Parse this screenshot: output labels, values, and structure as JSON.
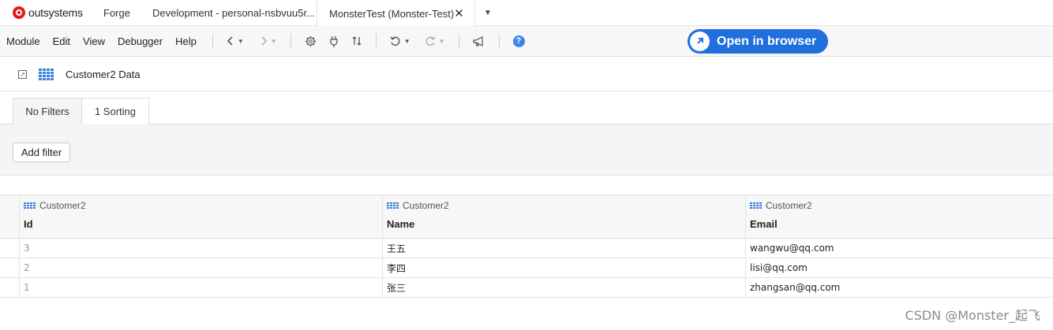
{
  "tabbar": {
    "logo_text": "outsystems",
    "tabs": [
      {
        "label": "Forge"
      },
      {
        "label": "Development - personal-nsbvuu5r..."
      },
      {
        "label": "MonsterTest (Monster-Test)"
      }
    ],
    "close_glyph": "✕",
    "more_glyph": "▼"
  },
  "menu": {
    "items": [
      "Module",
      "Edit",
      "View",
      "Debugger",
      "Help"
    ],
    "open_browser_label": "Open in browser"
  },
  "icons": {
    "back": "chevron-left-icon",
    "forward": "chevron-right-icon",
    "settings": "gear-icon",
    "plug": "plug-icon",
    "updown": "up-down-arrows-icon",
    "undo": "undo-icon",
    "redo": "redo-icon",
    "announce": "megaphone-icon",
    "help": "help-icon",
    "open_external": "open-external-icon",
    "entity": "table-grid-icon"
  },
  "colors": {
    "accent": "#1f6fdc",
    "logo_red": "#e21b1b",
    "entity_icon": "#3b7fd9"
  },
  "entity": {
    "title": "Customer2 Data"
  },
  "filters": {
    "tabs": [
      "No Filters",
      "1 Sorting"
    ],
    "add_filter_label": "Add filter"
  },
  "table": {
    "columns": [
      {
        "entity": "Customer2",
        "attribute": "Id"
      },
      {
        "entity": "Customer2",
        "attribute": "Name"
      },
      {
        "entity": "Customer2",
        "attribute": "Email"
      }
    ],
    "rows": [
      {
        "id": "3",
        "name": "王五",
        "email": "wangwu@qq.com"
      },
      {
        "id": "2",
        "name": "李四",
        "email": "lisi@qq.com"
      },
      {
        "id": "1",
        "name": "张三",
        "email": "zhangsan@qq.com"
      }
    ]
  },
  "watermark": "CSDN @Monster_起飞"
}
